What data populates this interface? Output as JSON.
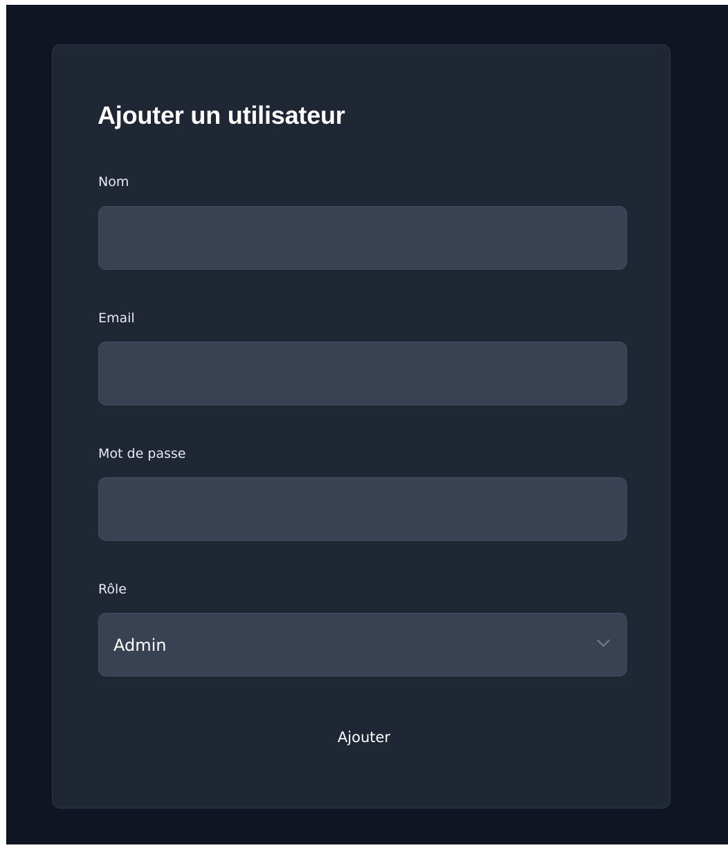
{
  "form": {
    "title": "Ajouter un utilisateur",
    "fields": [
      {
        "label": "Nom",
        "value": "",
        "placeholder": ""
      },
      {
        "label": "Email",
        "value": "",
        "placeholder": ""
      },
      {
        "label": "Mot de passe",
        "value": "",
        "placeholder": ""
      }
    ],
    "role": {
      "label": "Rôle",
      "selected": "Admin",
      "icon": "chevron-down-icon"
    },
    "submit_label": "Ajouter"
  },
  "colors": {
    "page_background": "#0f1522",
    "card_background": "#1f2735",
    "input_background": "#384252",
    "text": "#ffffff"
  }
}
